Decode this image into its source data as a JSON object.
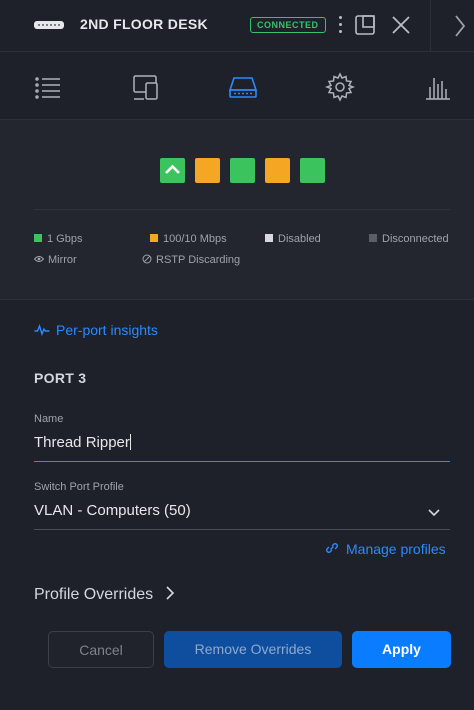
{
  "header": {
    "title": "2ND FLOOR DESK",
    "status_badge": "CONNECTED",
    "device_icon": "switch-device-icon",
    "actions": [
      "kebab-icon",
      "popout-icon",
      "close-icon",
      "chevron-right-icon"
    ]
  },
  "tabs": [
    {
      "icon": "list-icon",
      "active": false
    },
    {
      "icon": "devices-icon",
      "active": false
    },
    {
      "icon": "switch-ports-icon",
      "active": true
    },
    {
      "icon": "gear-icon",
      "active": false
    },
    {
      "icon": "statistics-icon",
      "active": false
    }
  ],
  "ports": [
    {
      "state": "1 Gbps",
      "selected": true,
      "color": "#3bc45e"
    },
    {
      "state": "100/10 Mbps",
      "selected": false,
      "color": "#f5a623"
    },
    {
      "state": "1 Gbps",
      "selected": false,
      "color": "#3bc45e"
    },
    {
      "state": "100/10 Mbps",
      "selected": false,
      "color": "#f5a623"
    },
    {
      "state": "1 Gbps",
      "selected": false,
      "color": "#3bc45e"
    }
  ],
  "legend": {
    "gbps": "1 Gbps",
    "mbps": "100/10 Mbps",
    "disabled": "Disabled",
    "disconnected": "Disconnected",
    "mirror": "Mirror",
    "rstp": "RSTP Discarding"
  },
  "colors": {
    "gbps": "#3bc45e",
    "mbps": "#f5a623",
    "disabled": "#d7d9de",
    "disconnected": "#5a5e68",
    "accent": "#2a8bff",
    "connected": "#38c16b"
  },
  "insights_link": "Per-port insights",
  "port_heading": "PORT 3",
  "name_field": {
    "label": "Name",
    "value": "Thread Ripper"
  },
  "profile_field": {
    "label": "Switch Port Profile",
    "value": "VLAN - Computers (50)"
  },
  "manage_profiles": "Manage profiles",
  "profile_overrides": "Profile Overrides",
  "buttons": {
    "cancel": "Cancel",
    "remove": "Remove Overrides",
    "apply": "Apply"
  }
}
